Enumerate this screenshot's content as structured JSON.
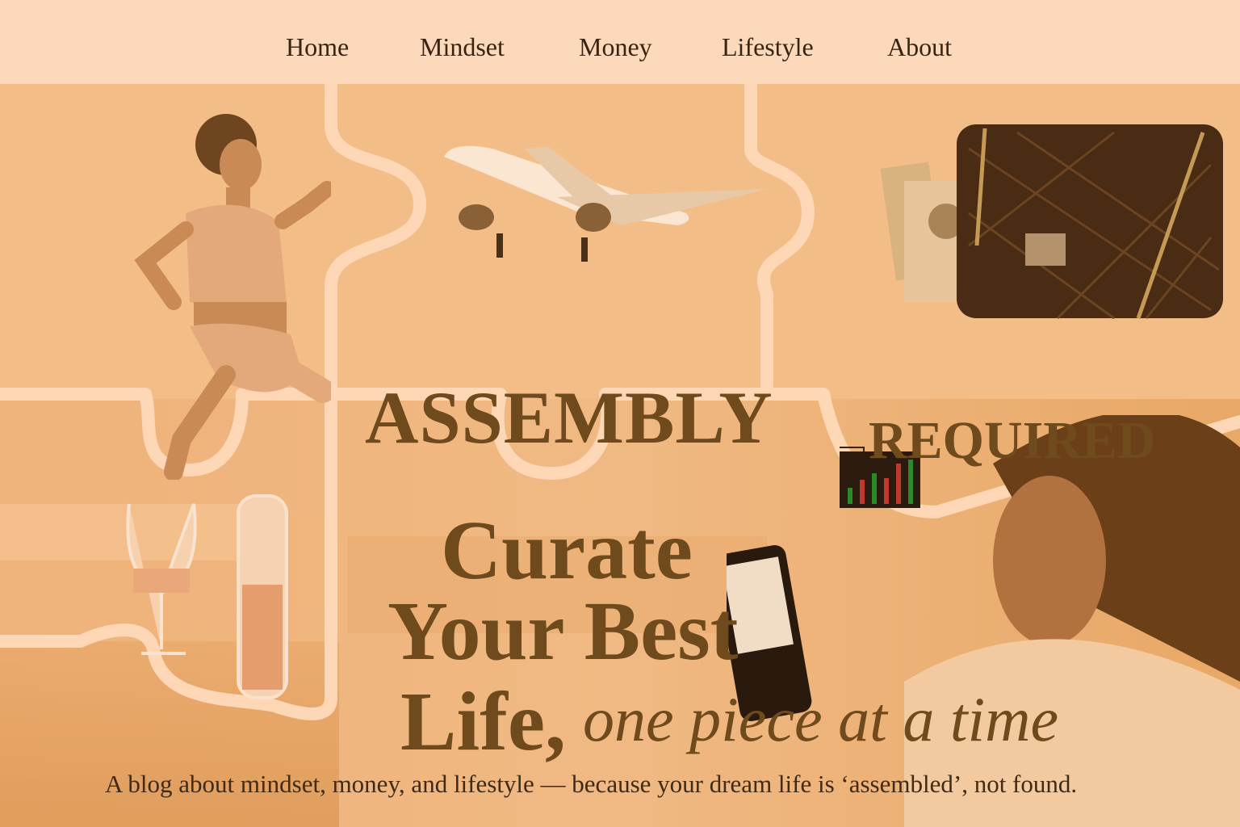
{
  "nav": {
    "items": [
      {
        "label": "Home"
      },
      {
        "label": "Mindset"
      },
      {
        "label": "Money"
      },
      {
        "label": "Lifestyle"
      },
      {
        "label": "About"
      }
    ]
  },
  "hero": {
    "brand": {
      "word1": "ASSEMBLY",
      "word2": "REQUIRED"
    },
    "headline": {
      "line1": "Curate",
      "line2": "Your Best",
      "line3": "Life,",
      "italic": "one piece at a time"
    },
    "tagline": "A blog about mindset, money, and lifestyle — because your dream life is ‘assembled’, not found."
  },
  "images": {
    "runner": "woman-running-photo",
    "airplane": "airplane-photo",
    "money_bag": "cash-and-quilted-handbag-photo",
    "drinks": "wine-glass-and-carafe-photo",
    "phone": "woman-with-phone-photo"
  },
  "colors": {
    "tint": "#f4c08c",
    "nav_bg": "#fdd9bc",
    "title": "#6e4a1c",
    "seam": "#fdd7b6"
  }
}
